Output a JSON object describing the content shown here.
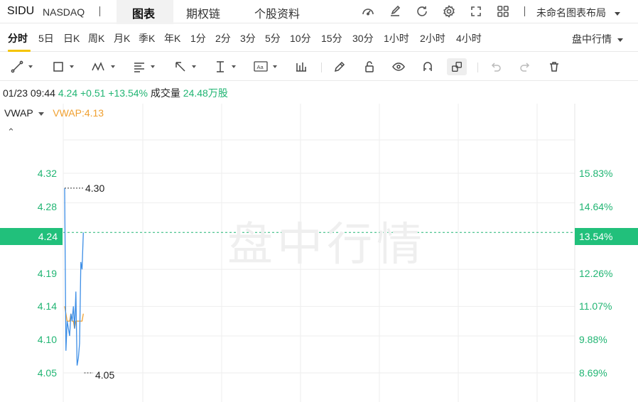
{
  "header": {
    "ticker": "SIDU",
    "exchange": "NASDAQ",
    "tabs": [
      {
        "label": "图表",
        "active": true
      },
      {
        "label": "期权链",
        "active": false
      },
      {
        "label": "个股资料",
        "active": false
      }
    ],
    "icons": [
      "speedometer-icon",
      "edit-icon",
      "refresh-icon",
      "settings-icon",
      "fullscreen-icon",
      "grid-icon"
    ],
    "layout_name": "未命名图表布局"
  },
  "timeframes": {
    "items": [
      "分时",
      "5日",
      "日K",
      "周K",
      "月K",
      "季K",
      "年K",
      "1分",
      "2分",
      "3分",
      "5分",
      "10分",
      "15分",
      "30分",
      "1小时",
      "2小时",
      "4小时"
    ],
    "active": "分时",
    "market_mode": "盘中行情"
  },
  "toolbar": {
    "tools": [
      "trendline-icon",
      "rectangle-icon",
      "pattern-icon",
      "fib-icon",
      "arrow-icon",
      "measure-icon",
      "text-icon",
      "indicator-icon",
      "pencil-icon",
      "lock-icon",
      "eye-icon",
      "magnet-icon",
      "link-icon",
      "undo-icon",
      "redo-icon",
      "trash-icon"
    ]
  },
  "quote": {
    "datetime": "01/23 09:44",
    "price": "4.24",
    "change": "+0.51",
    "change_pct": "+13.54%",
    "volume_label": "成交量",
    "volume_value": "24.48万股"
  },
  "indicator": {
    "name": "VWAP",
    "value_text": "VWAP:4.13"
  },
  "watermark": "盘中行情",
  "axis": {
    "left_ticks": [
      "4.32",
      "4.28",
      "4.24",
      "4.19",
      "4.14",
      "4.10",
      "4.05"
    ],
    "right_ticks": [
      "15.83%",
      "14.64%",
      "13.54%",
      "12.26%",
      "11.07%",
      "9.88%",
      "8.69%"
    ],
    "current_price": "4.24",
    "current_pct": "13.54%",
    "high_label": "4.30",
    "low_label": "4.05"
  },
  "colors": {
    "up": "#21b573",
    "price_line": "#3d8ee6",
    "vwap_line": "#f0a030",
    "active_underline": "#f5c400"
  },
  "chart_data": {
    "type": "line",
    "title": "",
    "xlabel": "",
    "ylabel": "",
    "ylim": [
      4.03,
      4.36
    ],
    "series": [
      {
        "name": "",
        "values": [
          4.3,
          4.08,
          4.12,
          4.11,
          4.1,
          4.13,
          4.12,
          4.14,
          4.11,
          4.16,
          4.06,
          4.07,
          4.09,
          4.2,
          4.19,
          4.24
        ]
      },
      {
        "name": "VWAP",
        "values": [
          4.14,
          4.13,
          4.12,
          4.12,
          4.12,
          4.13,
          4.12,
          4.12,
          4.11,
          4.12,
          4.12,
          4.12,
          4.12,
          4.12,
          4.12,
          4.13
        ]
      }
    ]
  }
}
